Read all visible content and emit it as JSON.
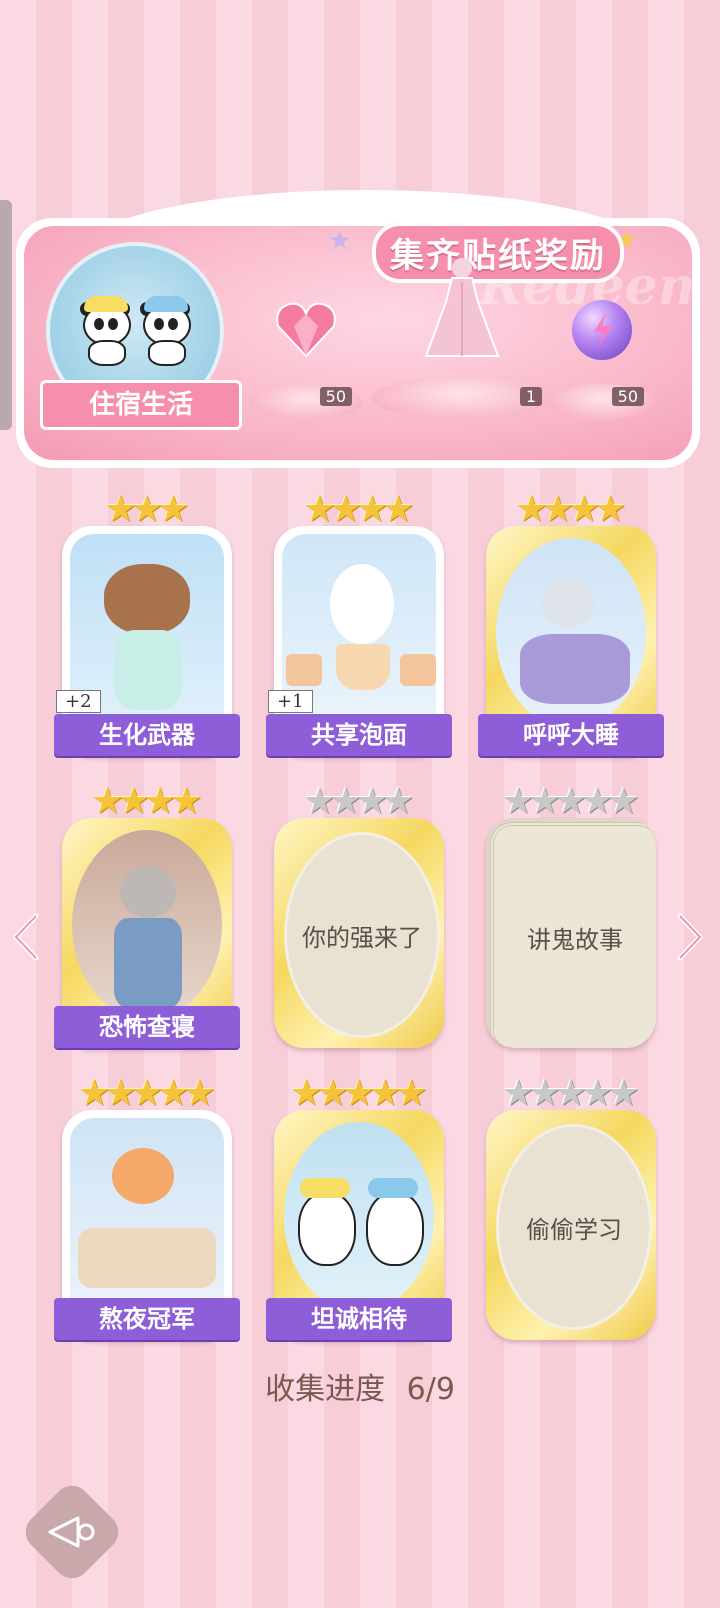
{
  "banner": {
    "title": "集齐贴纸奖励",
    "watermark": "Redeem",
    "category_label": "住宿生活",
    "rewards": [
      {
        "name": "heart-gem",
        "count": "50"
      },
      {
        "name": "dress-outfit",
        "count": "1"
      },
      {
        "name": "energy-orb",
        "count": "50"
      }
    ]
  },
  "stickers": [
    {
      "name": "生化武器",
      "stars": 3,
      "max_stars": 3,
      "collected": true,
      "badge": "+2",
      "frame": "white"
    },
    {
      "name": "共享泡面",
      "stars": 4,
      "max_stars": 4,
      "collected": true,
      "badge": "+1",
      "frame": "white"
    },
    {
      "name": "呼呼大睡",
      "stars": 4,
      "max_stars": 4,
      "collected": true,
      "badge": "",
      "frame": "gold"
    },
    {
      "name": "恐怖查寝",
      "stars": 4,
      "max_stars": 4,
      "collected": true,
      "badge": "",
      "frame": "gold"
    },
    {
      "name": "你的强来了",
      "stars": 0,
      "max_stars": 4,
      "collected": false,
      "badge": "",
      "frame": "gold"
    },
    {
      "name": "讲鬼故事",
      "stars": 0,
      "max_stars": 5,
      "collected": false,
      "badge": "",
      "frame": "ticket"
    },
    {
      "name": "熬夜冠军",
      "stars": 5,
      "max_stars": 5,
      "collected": true,
      "badge": "",
      "frame": "white"
    },
    {
      "name": "坦诚相待",
      "stars": 5,
      "max_stars": 5,
      "collected": true,
      "badge": "",
      "frame": "gold"
    },
    {
      "name": "偷偷学习",
      "stars": 0,
      "max_stars": 5,
      "collected": false,
      "badge": "",
      "frame": "gold"
    }
  ],
  "progress": {
    "label": "收集进度",
    "value": "6/9"
  },
  "nav": {
    "prev_icon": "chevron-left-icon",
    "next_icon": "chevron-right-icon",
    "back_icon": "back-arrow-icon"
  },
  "colors": {
    "name_banner": "#8e5dd8",
    "pink_accent": "#f58fac",
    "gold_star": "#f5c43a",
    "silver_star": "#c8c8c8"
  }
}
